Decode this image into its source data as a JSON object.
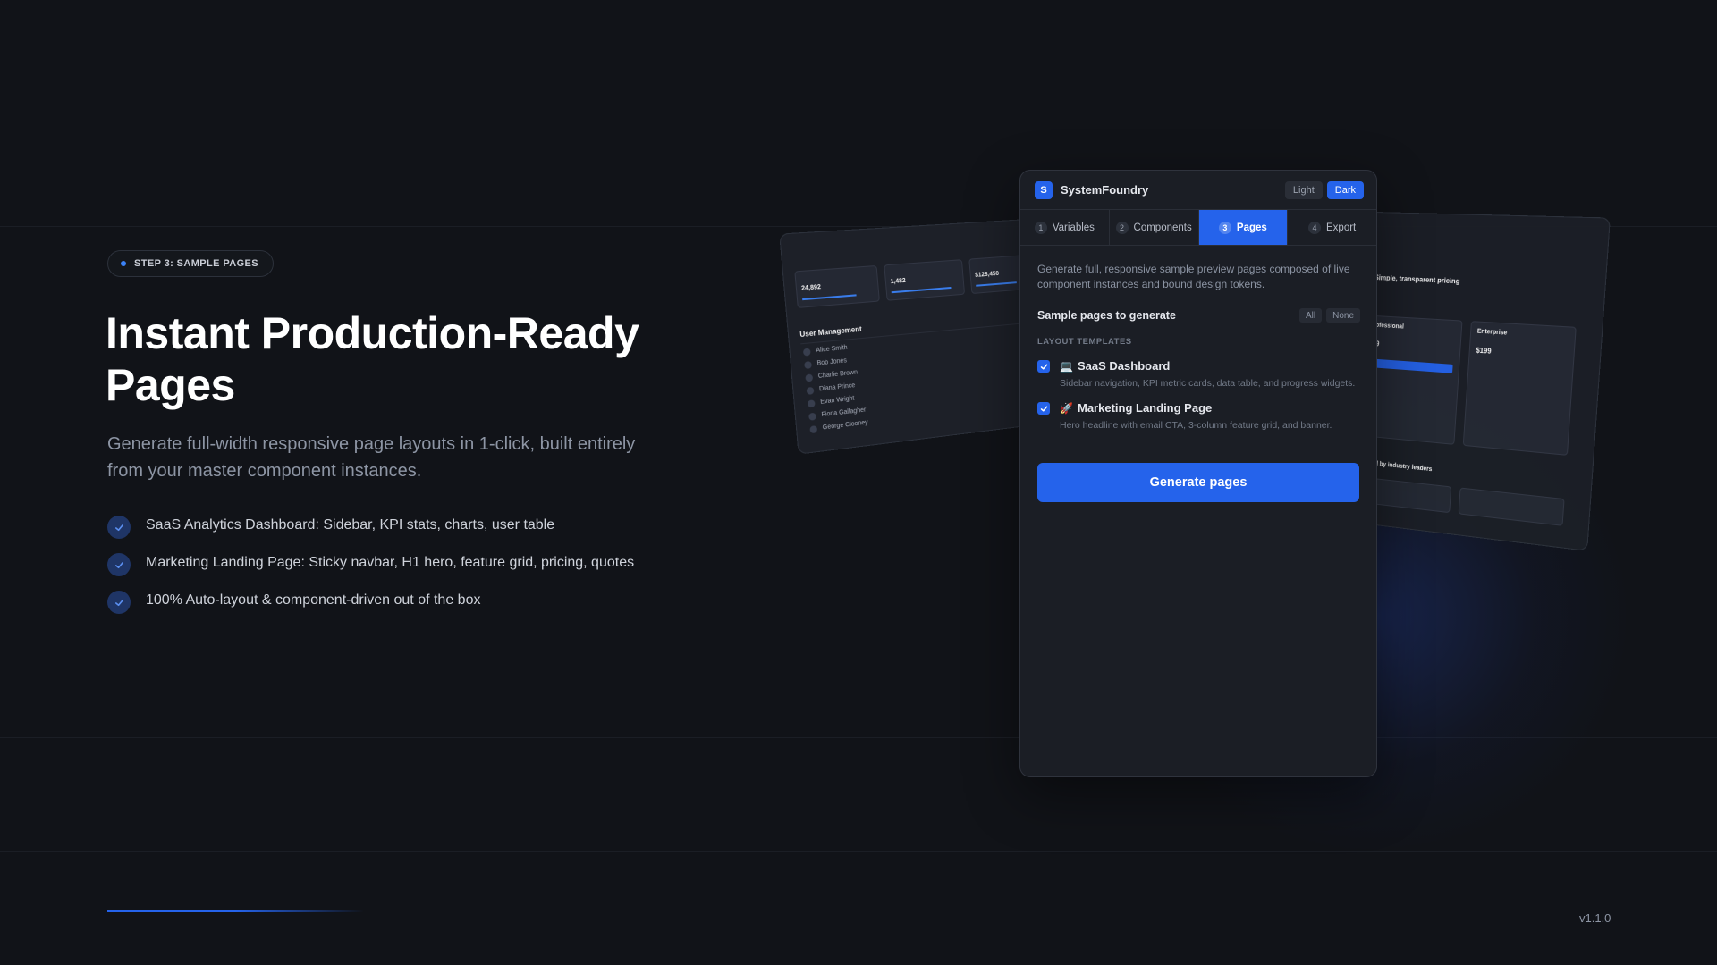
{
  "hero": {
    "badge": "STEP 3: SAMPLE PAGES",
    "title": "Instant Production-Ready Pages",
    "subtitle": "Generate full-width responsive page layouts in 1-click, built entirely from your master component instances.",
    "features": [
      "SaaS Analytics Dashboard: Sidebar, KPI stats, charts, user table",
      "Marketing Landing Page: Sticky navbar, H1 hero, feature grid, pricing, quotes",
      "100% Auto-layout & component-driven out of the box"
    ]
  },
  "footer": {
    "version": "v1.1.0",
    "step_progress": 0.3
  },
  "panel": {
    "logo_letter": "S",
    "app_name": "SystemFoundry",
    "theme": {
      "light_label": "Light",
      "dark_label": "Dark",
      "selected": "Dark"
    },
    "tabs": [
      {
        "num": "1",
        "label": "Variables"
      },
      {
        "num": "2",
        "label": "Components"
      },
      {
        "num": "3",
        "label": "Pages"
      },
      {
        "num": "4",
        "label": "Export"
      }
    ],
    "active_tab": "Pages",
    "description": "Generate full, responsive sample preview pages composed of live component instances and bound design tokens.",
    "section_title": "Sample pages to generate",
    "select_all": "All",
    "select_none": "None",
    "group_label": "LAYOUT TEMPLATES",
    "templates": [
      {
        "emoji": "💻",
        "name": "SaaS Dashboard",
        "description": "Sidebar navigation, KPI metric cards, data table, and progress widgets.",
        "checked": true
      },
      {
        "emoji": "🚀",
        "name": "Marketing Landing Page",
        "description": "Hero headline with email CTA, 3-column feature grid, and banner.",
        "checked": true
      }
    ],
    "generate_label": "Generate pages"
  },
  "preview_dashboard": {
    "kpis": [
      "24,892",
      "1,482",
      "$128,450"
    ],
    "section": "User Management",
    "names": [
      "Alice Smith",
      "Bob Jones",
      "Charlie Brown",
      "Diana Prince",
      "Evan Wright",
      "Fiona Gallagher",
      "George Clooney"
    ]
  },
  "preview_landing": {
    "pricing_title": "Simple, transparent pricing",
    "plans": [
      {
        "name": "Professional",
        "price": "$79"
      },
      {
        "name": "Enterprise",
        "price": "$199"
      }
    ],
    "trusted": "Trusted by industry leaders"
  },
  "colors": {
    "accent": "#2563eb",
    "background": "#111318",
    "panel": "#1b1e25"
  }
}
